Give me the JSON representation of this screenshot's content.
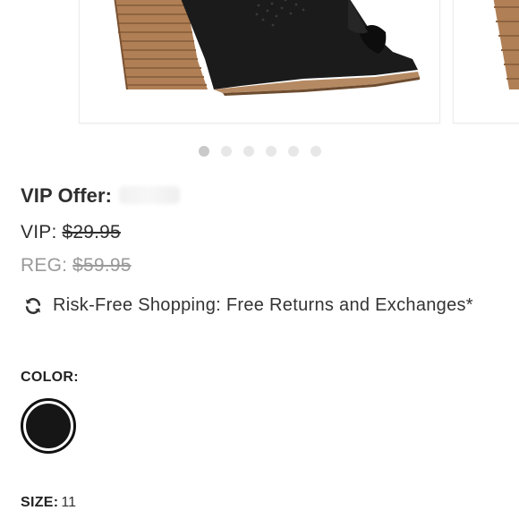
{
  "carousel": {
    "slide_count": 6,
    "active_index": 0,
    "product_image": "black-suede-peep-toe-stacked-heel-bootie"
  },
  "pricing": {
    "vip_offer_label": "VIP Offer:",
    "vip_label": "VIP:",
    "vip_price": "$29.95",
    "reg_label": "REG:",
    "reg_price": "$59.95"
  },
  "policy": {
    "icon": "refresh-icon",
    "text": "Risk-Free Shopping: Free Returns and Exchanges*"
  },
  "color": {
    "label": "COLOR:",
    "selected_swatch_hex": "#161616"
  },
  "size": {
    "label": "SIZE:",
    "value": "11"
  },
  "colors": {
    "text": "#2f2f2f",
    "muted": "#9a9a9a",
    "dot_active": "#c9c9c9",
    "dot_inactive": "#e7e7e7"
  }
}
